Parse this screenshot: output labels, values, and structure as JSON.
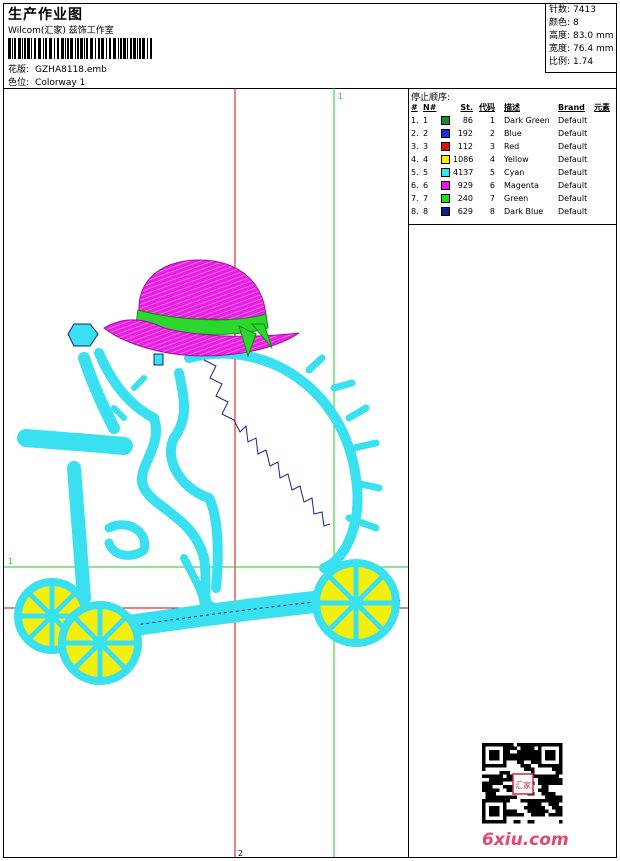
{
  "header": {
    "title": "生产作业图",
    "company": "Wilcom(汇家) 兹饰工作室",
    "design_label": "花版:",
    "design_value": "GZHA8118.emb",
    "colorway_label": "色位:",
    "colorway_value": "Colorway 1"
  },
  "stats": {
    "stitches_label": "针数:",
    "stitches_value": "7413",
    "colors_label": "颜色:",
    "colors_value": "8",
    "height_label": "高度:",
    "height_value": "83.0 mm",
    "width_label": "宽度:",
    "width_value": "76.4 mm",
    "ratio_label": "比例:",
    "ratio_value": "1.74"
  },
  "stop_sequence": {
    "title": "停止顺序:",
    "headers": {
      "idx": "#",
      "no": "N#",
      "st": "St.",
      "code": "代码",
      "desc": "描述",
      "brand": "Brand",
      "elem": "元素"
    },
    "rows": [
      {
        "idx": "1.",
        "no": "1",
        "color": "#1a8a2a",
        "st": "86",
        "code": "1",
        "desc": "Dark Green",
        "brand": "Default"
      },
      {
        "idx": "2.",
        "no": "2",
        "color": "#1030e0",
        "st": "192",
        "code": "2",
        "desc": "Blue",
        "brand": "Default"
      },
      {
        "idx": "3.",
        "no": "3",
        "color": "#e01010",
        "st": "112",
        "code": "3",
        "desc": "Red",
        "brand": "Default"
      },
      {
        "idx": "4.",
        "no": "4",
        "color": "#f5f000",
        "st": "1086",
        "code": "4",
        "desc": "Yellow",
        "brand": "Default"
      },
      {
        "idx": "5.",
        "no": "5",
        "color": "#30e8e8",
        "st": "4137",
        "code": "5",
        "desc": "Cyan",
        "brand": "Default"
      },
      {
        "idx": "6.",
        "no": "6",
        "color": "#f010f0",
        "st": "929",
        "code": "6",
        "desc": "Magenta",
        "brand": "Default"
      },
      {
        "idx": "7.",
        "no": "7",
        "color": "#20e020",
        "st": "240",
        "code": "7",
        "desc": "Green",
        "brand": "Default"
      },
      {
        "idx": "8.",
        "no": "8",
        "color": "#10208a",
        "st": "629",
        "code": "8",
        "desc": "Dark Blue",
        "brand": "Default"
      }
    ]
  },
  "guides": {
    "v1": "1",
    "h1": "1",
    "h2": "2",
    "v2": "2"
  },
  "colors": {
    "cyan": "#38e0f0",
    "magenta": "#e81ee0",
    "green": "#2cd62c",
    "yellow": "#f2ee10",
    "darkblue": "#1a2290",
    "red_guide": "#e00000",
    "green_guide": "#22cc22"
  },
  "footer": {
    "logo": "6xiu.com",
    "stamp": "汇家"
  }
}
